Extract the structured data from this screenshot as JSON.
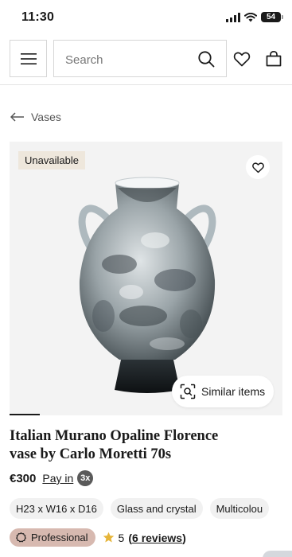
{
  "status_bar": {
    "time": "11:30",
    "battery": "54"
  },
  "header": {
    "search_placeholder": "Search"
  },
  "breadcrumb": {
    "label": "Vases"
  },
  "product": {
    "badge": "Unavailable",
    "similar_items_label": "Similar items",
    "title_line1": "Italian Murano Opaline Florence",
    "title_line2": "vase by Carlo Moretti 70s",
    "price": "€300",
    "pay_in_label": "Pay in",
    "pay_in_count": "3x",
    "chips": [
      "H23 x W16 x D16",
      "Glass and crystal",
      "Multicolou"
    ],
    "seller_badge": "Professional",
    "rating": "5",
    "reviews_open": "(",
    "reviews_label": "6 reviews",
    "reviews_close": ")"
  },
  "colors": {
    "badge_bg": "#eee7dc",
    "pro_badge_bg": "#d7b9b0",
    "text": "#1a1a1a"
  }
}
